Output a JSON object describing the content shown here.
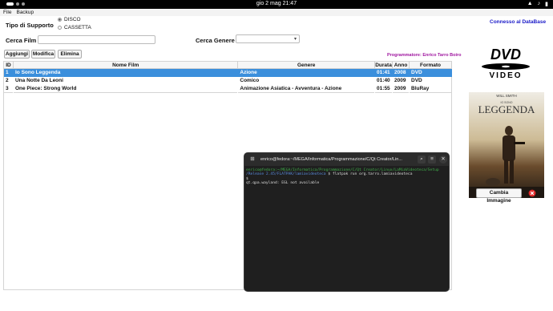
{
  "system_bar": {
    "clock": "gio 2 mag  21:47",
    "tray_icons": [
      "network-icon",
      "audio-icon",
      "battery-icon"
    ]
  },
  "menu": {
    "items": [
      "File",
      "Backup"
    ]
  },
  "support": {
    "label": "Tipo di Supporto",
    "options": [
      {
        "label": "DISCO",
        "selected": true
      },
      {
        "label": "CASSETTA",
        "selected": false
      }
    ]
  },
  "search": {
    "film_label": "Cerca Film",
    "film_value": "",
    "genre_label": "Cerca Genere",
    "genre_value": ""
  },
  "actions": {
    "add": "Aggiungi",
    "edit": "Modifica",
    "delete": "Elimina"
  },
  "status": {
    "db": "Connesso al DataBase",
    "credits": "Programmatore: Enrico Tarro Boiro"
  },
  "table": {
    "columns": [
      "ID",
      "Nome Film",
      "Genere",
      "Durata",
      "Anno",
      "Formato"
    ],
    "rows": [
      {
        "id": "1",
        "name": "Io Sono Leggenda",
        "genre": "Azione",
        "duration": "01:41",
        "year": "2008",
        "format": "DVD",
        "selected": true
      },
      {
        "id": "2",
        "name": "Una Notte Da Leoni",
        "genre": "Comico",
        "duration": "01:40",
        "year": "2009",
        "format": "DVD",
        "selected": false
      },
      {
        "id": "3",
        "name": "One Piece: Strong World",
        "genre": "Animazione Asiatica - Avventura - Azione",
        "duration": "01:55",
        "year": "2009",
        "format": "BluRay",
        "selected": false
      }
    ]
  },
  "cover": {
    "logo_text": "DVD",
    "logo_sub": "VIDEO",
    "poster_actor": "WILL SMITH",
    "poster_title": "LEGGENDA",
    "poster_prefix": "IO SONO",
    "change_button": "Cambia Immagine"
  },
  "terminal": {
    "title": "enrico@fedora:~/MEGA/Informatica/Programmazione/C/Qt Creator/Lin...",
    "lines": [
      {
        "prompt": "enrico@fedora:~/MEGA/Informatica/Programmazione/C/Qt Creator/Linux/LaMiaVideoteca/Setup",
        "cmd": ""
      },
      {
        "prompt": "/Release 2.45/FLATPAK/lamiavideoteca",
        "cmd": "$ flatpak run org.tarro.lamiavideoteca"
      },
      {
        "prompt": "",
        "cmd": "$"
      },
      {
        "prompt": "",
        "cmd": "qt.qpa.wayland: EGL not available"
      }
    ]
  },
  "colors": {
    "selection": "#3b8fdc",
    "db_status": "#1919c8",
    "credits": "#a017a0"
  }
}
